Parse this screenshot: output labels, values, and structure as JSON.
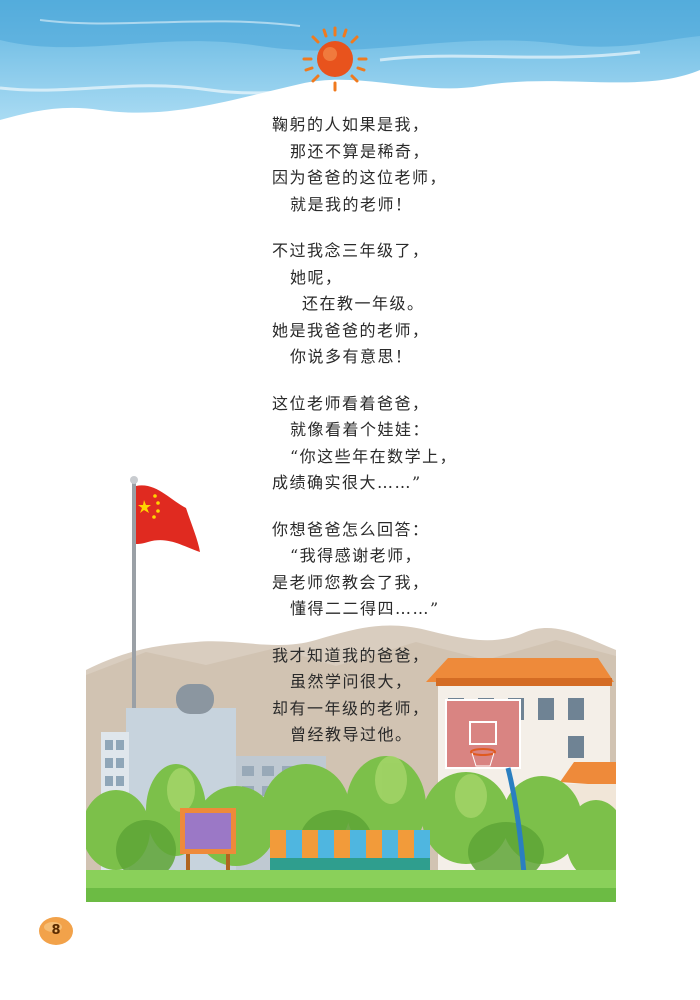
{
  "poem": {
    "stanzas": [
      {
        "lines": [
          {
            "text": "鞠躬的人如果是我，",
            "indent": 0
          },
          {
            "text": "那还不算是稀奇，",
            "indent": 1
          },
          {
            "text": "因为爸爸的这位老师，",
            "indent": 0
          },
          {
            "text": "就是我的老师！",
            "indent": 1
          }
        ]
      },
      {
        "lines": [
          {
            "text": "不过我念三年级了，",
            "indent": 0
          },
          {
            "text": "她呢，",
            "indent": 1
          },
          {
            "text": "还在教一年级。",
            "indent": 2
          },
          {
            "text": "她是我爸爸的老师，",
            "indent": 0
          },
          {
            "text": "你说多有意思！",
            "indent": 1
          }
        ]
      },
      {
        "lines": [
          {
            "text": "这位老师看着爸爸，",
            "indent": 0
          },
          {
            "text": "就像看着个娃娃：",
            "indent": 1
          },
          {
            "text": "“你这些年在数学上，",
            "indent": 1
          },
          {
            "text": "成绩确实很大……”",
            "indent": 0
          }
        ]
      },
      {
        "lines": [
          {
            "text": "你想爸爸怎么回答：",
            "indent": 0
          },
          {
            "text": "“我得感谢老师，",
            "indent": 1
          },
          {
            "text": "是老师您教会了我，",
            "indent": 0
          },
          {
            "text": "懂得二二得四……”",
            "indent": 1
          }
        ]
      },
      {
        "lines": [
          {
            "text": "我才知道我的爸爸，",
            "indent": 0
          },
          {
            "text": "虽然学问很大，",
            "indent": 1
          },
          {
            "text": "却有一年级的老师，",
            "indent": 0
          },
          {
            "text": "曾经教导过他。",
            "indent": 1
          }
        ]
      }
    ]
  },
  "page": {
    "number": "8"
  },
  "colors": {
    "sky": "#7ec3e6",
    "sun": "#e8531d",
    "badge": "#f2a24a",
    "flag": "#e02a20"
  },
  "icons": [
    "sun-icon",
    "flag-icon",
    "basketball-hoop-icon"
  ]
}
